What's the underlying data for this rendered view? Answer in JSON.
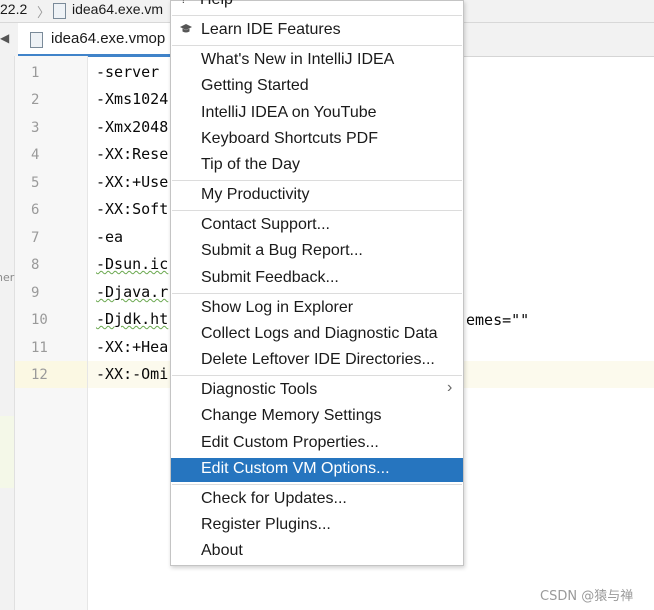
{
  "breadcrumb": {
    "version": "22.2",
    "file": "idea64.exe.vm"
  },
  "tab": {
    "label": "idea64.exe.vmop"
  },
  "side_strip_text": "ner",
  "editor": {
    "line_numbers": [
      "1",
      "2",
      "3",
      "4",
      "5",
      "6",
      "7",
      "8",
      "9",
      "10",
      "11",
      "12"
    ],
    "lines": [
      "-server",
      "-Xms1024",
      "-Xmx2048",
      "-XX:Rese",
      "-XX:+Use",
      "-XX:Soft",
      "-ea",
      "-Dsun.ic",
      "-Djava.r",
      "-Djdk.ht",
      "-XX:+Hea",
      "-XX:-Omi"
    ],
    "line10_tail": "emes=\"\""
  },
  "menu": {
    "help_label": "Help",
    "learn_features": "Learn IDE Features",
    "group1": [
      "What's New in IntelliJ IDEA",
      "Getting Started",
      "IntelliJ IDEA on YouTube",
      "Keyboard Shortcuts PDF",
      "Tip of the Day"
    ],
    "productivity": "My Productivity",
    "group2": [
      "Contact Support...",
      "Submit a Bug Report...",
      "Submit Feedback..."
    ],
    "group3": [
      "Show Log in Explorer",
      "Collect Logs and Diagnostic Data",
      "Delete Leftover IDE Directories..."
    ],
    "group4": [
      "Diagnostic Tools",
      "Change Memory Settings",
      "Edit Custom Properties...",
      "Edit Custom VM Options..."
    ],
    "group5": [
      "Check for Updates...",
      "Register Plugins...",
      "About"
    ],
    "selected_item": "Edit Custom VM Options..."
  },
  "watermark": "CSDN @猿与禅",
  "colors": {
    "selection": "#2675bf",
    "tab_underline": "#4083c9"
  }
}
